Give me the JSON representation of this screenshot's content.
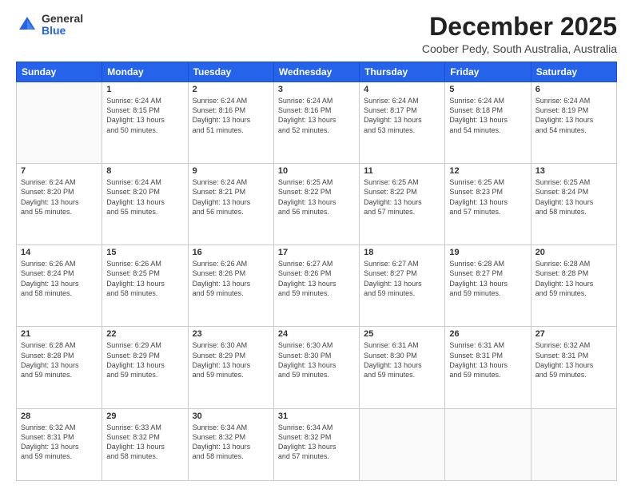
{
  "logo": {
    "general": "General",
    "blue": "Blue"
  },
  "header": {
    "month": "December 2025",
    "location": "Coober Pedy, South Australia, Australia"
  },
  "weekdays": [
    "Sunday",
    "Monday",
    "Tuesday",
    "Wednesday",
    "Thursday",
    "Friday",
    "Saturday"
  ],
  "weeks": [
    [
      {
        "day": "",
        "info": ""
      },
      {
        "day": "1",
        "info": "Sunrise: 6:24 AM\nSunset: 8:15 PM\nDaylight: 13 hours\nand 50 minutes."
      },
      {
        "day": "2",
        "info": "Sunrise: 6:24 AM\nSunset: 8:16 PM\nDaylight: 13 hours\nand 51 minutes."
      },
      {
        "day": "3",
        "info": "Sunrise: 6:24 AM\nSunset: 8:16 PM\nDaylight: 13 hours\nand 52 minutes."
      },
      {
        "day": "4",
        "info": "Sunrise: 6:24 AM\nSunset: 8:17 PM\nDaylight: 13 hours\nand 53 minutes."
      },
      {
        "day": "5",
        "info": "Sunrise: 6:24 AM\nSunset: 8:18 PM\nDaylight: 13 hours\nand 54 minutes."
      },
      {
        "day": "6",
        "info": "Sunrise: 6:24 AM\nSunset: 8:19 PM\nDaylight: 13 hours\nand 54 minutes."
      }
    ],
    [
      {
        "day": "7",
        "info": "Sunrise: 6:24 AM\nSunset: 8:20 PM\nDaylight: 13 hours\nand 55 minutes."
      },
      {
        "day": "8",
        "info": "Sunrise: 6:24 AM\nSunset: 8:20 PM\nDaylight: 13 hours\nand 55 minutes."
      },
      {
        "day": "9",
        "info": "Sunrise: 6:24 AM\nSunset: 8:21 PM\nDaylight: 13 hours\nand 56 minutes."
      },
      {
        "day": "10",
        "info": "Sunrise: 6:25 AM\nSunset: 8:22 PM\nDaylight: 13 hours\nand 56 minutes."
      },
      {
        "day": "11",
        "info": "Sunrise: 6:25 AM\nSunset: 8:22 PM\nDaylight: 13 hours\nand 57 minutes."
      },
      {
        "day": "12",
        "info": "Sunrise: 6:25 AM\nSunset: 8:23 PM\nDaylight: 13 hours\nand 57 minutes."
      },
      {
        "day": "13",
        "info": "Sunrise: 6:25 AM\nSunset: 8:24 PM\nDaylight: 13 hours\nand 58 minutes."
      }
    ],
    [
      {
        "day": "14",
        "info": "Sunrise: 6:26 AM\nSunset: 8:24 PM\nDaylight: 13 hours\nand 58 minutes."
      },
      {
        "day": "15",
        "info": "Sunrise: 6:26 AM\nSunset: 8:25 PM\nDaylight: 13 hours\nand 58 minutes."
      },
      {
        "day": "16",
        "info": "Sunrise: 6:26 AM\nSunset: 8:26 PM\nDaylight: 13 hours\nand 59 minutes."
      },
      {
        "day": "17",
        "info": "Sunrise: 6:27 AM\nSunset: 8:26 PM\nDaylight: 13 hours\nand 59 minutes."
      },
      {
        "day": "18",
        "info": "Sunrise: 6:27 AM\nSunset: 8:27 PM\nDaylight: 13 hours\nand 59 minutes."
      },
      {
        "day": "19",
        "info": "Sunrise: 6:28 AM\nSunset: 8:27 PM\nDaylight: 13 hours\nand 59 minutes."
      },
      {
        "day": "20",
        "info": "Sunrise: 6:28 AM\nSunset: 8:28 PM\nDaylight: 13 hours\nand 59 minutes."
      }
    ],
    [
      {
        "day": "21",
        "info": "Sunrise: 6:28 AM\nSunset: 8:28 PM\nDaylight: 13 hours\nand 59 minutes."
      },
      {
        "day": "22",
        "info": "Sunrise: 6:29 AM\nSunset: 8:29 PM\nDaylight: 13 hours\nand 59 minutes."
      },
      {
        "day": "23",
        "info": "Sunrise: 6:30 AM\nSunset: 8:29 PM\nDaylight: 13 hours\nand 59 minutes."
      },
      {
        "day": "24",
        "info": "Sunrise: 6:30 AM\nSunset: 8:30 PM\nDaylight: 13 hours\nand 59 minutes."
      },
      {
        "day": "25",
        "info": "Sunrise: 6:31 AM\nSunset: 8:30 PM\nDaylight: 13 hours\nand 59 minutes."
      },
      {
        "day": "26",
        "info": "Sunrise: 6:31 AM\nSunset: 8:31 PM\nDaylight: 13 hours\nand 59 minutes."
      },
      {
        "day": "27",
        "info": "Sunrise: 6:32 AM\nSunset: 8:31 PM\nDaylight: 13 hours\nand 59 minutes."
      }
    ],
    [
      {
        "day": "28",
        "info": "Sunrise: 6:32 AM\nSunset: 8:31 PM\nDaylight: 13 hours\nand 59 minutes."
      },
      {
        "day": "29",
        "info": "Sunrise: 6:33 AM\nSunset: 8:32 PM\nDaylight: 13 hours\nand 58 minutes."
      },
      {
        "day": "30",
        "info": "Sunrise: 6:34 AM\nSunset: 8:32 PM\nDaylight: 13 hours\nand 58 minutes."
      },
      {
        "day": "31",
        "info": "Sunrise: 6:34 AM\nSunset: 8:32 PM\nDaylight: 13 hours\nand 57 minutes."
      },
      {
        "day": "",
        "info": ""
      },
      {
        "day": "",
        "info": ""
      },
      {
        "day": "",
        "info": ""
      }
    ]
  ]
}
